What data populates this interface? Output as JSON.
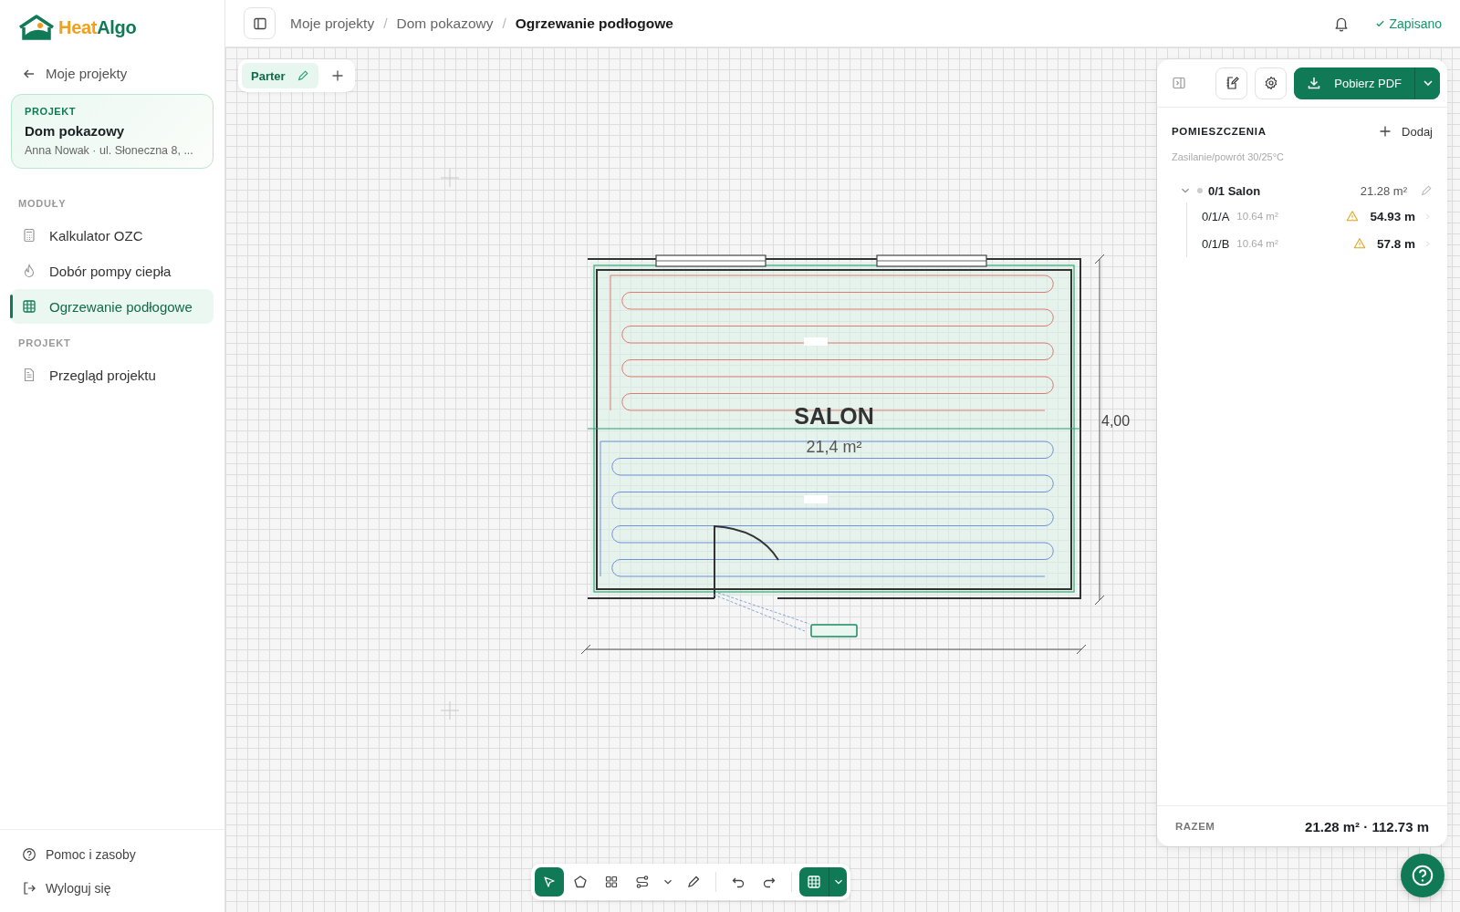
{
  "sidebar": {
    "logo": {
      "part_1": "Heat",
      "part_2": "Algo"
    },
    "back_link": "Moje projekty",
    "project_card": {
      "label": "PROJEKT",
      "name": "Dom pokazowy",
      "details": "Anna Nowak · ul. Słoneczna 8, ..."
    },
    "sections": [
      {
        "heading": "MODUŁY",
        "items": [
          {
            "label": "Kalkulator OZC",
            "kind": "calculator",
            "selected": false
          },
          {
            "label": "Dobór pompy ciepła",
            "kind": "flame",
            "selected": false
          },
          {
            "label": "Ogrzewanie podłogowe",
            "kind": "grid",
            "selected": true
          }
        ]
      },
      {
        "heading": "PROJEKT",
        "items": [
          {
            "label": "Przegląd projektu",
            "kind": "document",
            "selected": false
          }
        ]
      }
    ],
    "footer_links": [
      {
        "label": "Pomoc i zasoby",
        "kind": "help"
      },
      {
        "label": "Wyloguj się",
        "kind": "logout"
      }
    ]
  },
  "header": {
    "separator": "/",
    "breadcrumbs": [
      {
        "label": "Moje projekty",
        "current": false
      },
      {
        "label": "Dom pokazowy",
        "current": false
      },
      {
        "label": "Ogrzewanie podłogowe",
        "current": true
      }
    ],
    "save_status": "Zapisano"
  },
  "floor_tabs": [
    {
      "label": "Parter",
      "selected": true
    }
  ],
  "plan": {
    "room_name": "SALON",
    "room_area": "21,4 m²",
    "height_dimension": "4,00"
  },
  "panel": {
    "pdf_button": "Pobierz PDF",
    "heading": "POMIESZCZENIA",
    "add_button": "Dodaj",
    "subtitle": "Zasilanie/powrót 30/25°C",
    "rooms": [
      {
        "name": "0/1 Salon",
        "area": "21.28 m²",
        "expanded": true,
        "loops": [
          {
            "name": "0/1/A",
            "area": "10.64 m²",
            "length": "54.93 m",
            "warning": true
          },
          {
            "name": "0/1/B",
            "area": "10.64 m²",
            "length": "57.8 m",
            "warning": true
          }
        ]
      }
    ],
    "total_label": "RAZEM",
    "total_value": "21.28 m² · 112.73 m"
  },
  "toolbar": {
    "tools": [
      {
        "kind": "select",
        "selected": true
      },
      {
        "kind": "polygon",
        "selected": false
      },
      {
        "kind": "blocks",
        "selected": false
      },
      {
        "kind": "route",
        "selected": false
      },
      {
        "kind": "dropdown",
        "selected": false
      },
      {
        "kind": "pencil",
        "selected": false
      },
      {
        "kind": "undo",
        "selected": false
      },
      {
        "kind": "redo",
        "selected": false
      }
    ],
    "grid_toggle": {
      "on": true
    }
  }
}
